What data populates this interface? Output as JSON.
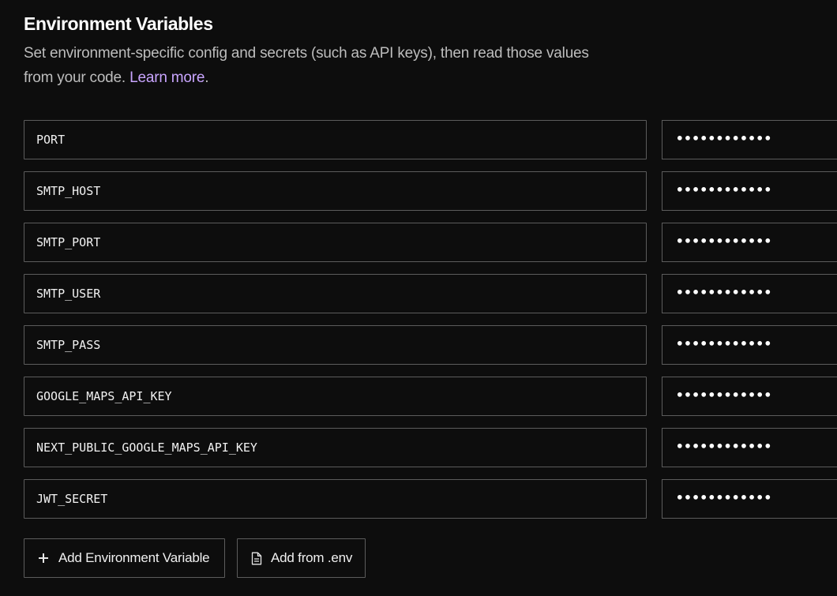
{
  "header": {
    "title": "Environment Variables",
    "description": "Set environment-specific config and secrets (such as API keys), then read those values from your code.",
    "learn_more": "Learn more",
    "trailing": "."
  },
  "variables": [
    {
      "key": "PORT",
      "value_mask": "••••••••••••"
    },
    {
      "key": "SMTP_HOST",
      "value_mask": "••••••••••••"
    },
    {
      "key": "SMTP_PORT",
      "value_mask": "••••••••••••"
    },
    {
      "key": "SMTP_USER",
      "value_mask": "••••••••••••"
    },
    {
      "key": "SMTP_PASS",
      "value_mask": "••••••••••••"
    },
    {
      "key": "GOOGLE_MAPS_API_KEY",
      "value_mask": "••••••••••••"
    },
    {
      "key": "NEXT_PUBLIC_GOOGLE_MAPS_API_KEY",
      "value_mask": "••••••••••••"
    },
    {
      "key": "JWT_SECRET",
      "value_mask": "••••••••••••"
    }
  ],
  "actions": {
    "add_variable": "Add Environment Variable",
    "add_from_env": "Add from .env",
    "add_variable_icon": "plus-icon",
    "add_from_env_icon": "file-icon"
  },
  "colors": {
    "background": "#0d0d0d",
    "border": "#5c5c5c",
    "link": "#c9a5ff",
    "text": "#ffffff",
    "muted_text": "#bdbdbd"
  }
}
